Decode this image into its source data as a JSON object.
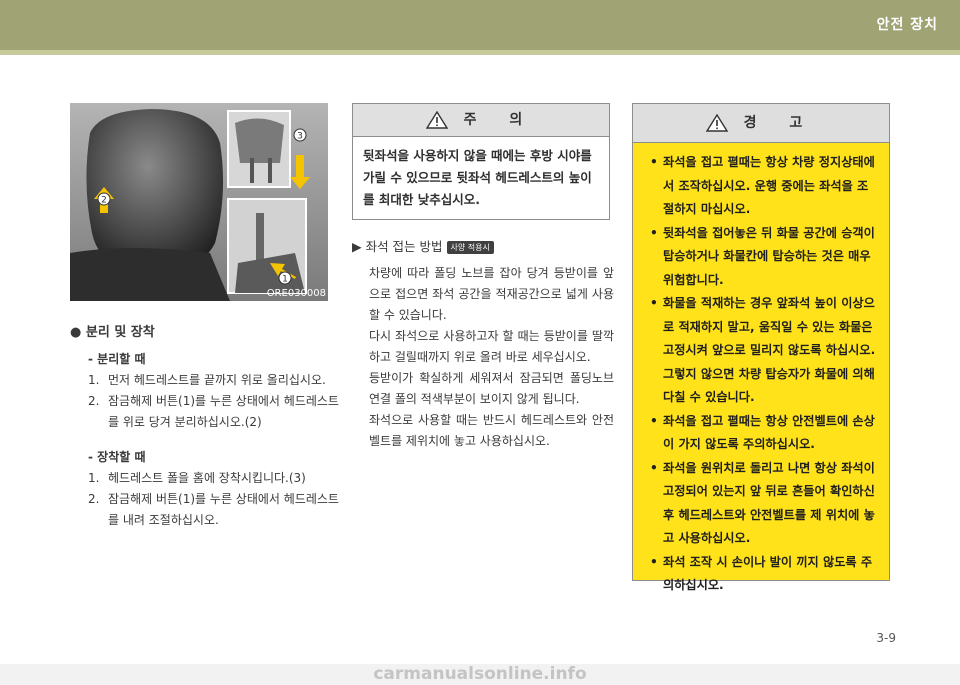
{
  "header": {
    "section": "안전 장치"
  },
  "figure": {
    "caption": "ORE030008",
    "marker1": "1",
    "marker2": "2",
    "marker3": "3"
  },
  "left": {
    "heading": "● 분리 및 장착",
    "sub1": "- 분리할 때",
    "s1_items": [
      {
        "num": "1.",
        "text": "먼저 헤드레스트를 끝까지 위로 올리십시오."
      },
      {
        "num": "2.",
        "text": "잠금해제 버튼(1)를 누른 상태에서 헤드레스트를 위로 당겨 분리하십시오.(2)"
      }
    ],
    "sub2": "- 장착할 때",
    "s2_items": [
      {
        "num": "1.",
        "text": "헤드레스트 폴을 홈에 장착시킵니다.(3)"
      },
      {
        "num": "2.",
        "text": "잠금해제 버튼(1)를 누른 상태에서 헤드레스트를 내려 조절하십시오."
      }
    ]
  },
  "caution": {
    "title": "주 의",
    "text": "뒷좌석을 사용하지 않을 때에는 후방 시야를 가릴 수 있으므로 뒷좌석 헤드레스트의 높이를 최대한 낮추십시오."
  },
  "mid": {
    "heading": "▶ 좌석 접는 방법",
    "badge": "사양 적용시",
    "paras": [
      "차량에 따라 폴딩 노브를 잡아 당겨 등받이를 앞으로 접으면 좌석 공간을 적재공간으로 넓게 사용할 수 있습니다.",
      "다시 좌석으로 사용하고자 할 때는 등받이를 딸깍하고 걸릴때까지 위로 올려 바로 세우십시오.",
      "등받이가 확실하게 세워져서 잠금되면 폴딩노브 연결 폴의 적색부분이 보이지 않게 됩니다.",
      "좌석으로 사용할 때는 반드시 헤드레스트와 안전벨트를 제위치에 놓고 사용하십시오."
    ]
  },
  "warning": {
    "title": "경 고",
    "items": [
      "좌석을 접고 펼때는 항상 차량 정지상태에서 조작하십시오. 운행 중에는 좌석을 조절하지 마십시오.",
      "뒷좌석을 접어놓은 뒤 화물 공간에 승객이 탑승하거나 화물칸에 탑승하는 것은 매우 위험합니다.",
      "화물을 적재하는 경우 앞좌석 높이 이상으로 적재하지 말고, 움직일 수 있는 화물은 고정시켜 앞으로 밀리지 않도록 하십시오. 그렇지 않으면 차량 탑승자가 화물에 의해 다칠 수 있습니다.",
      "좌석을 접고 펼때는 항상 안전벨트에 손상이 가지 않도록 주의하십시오.",
      "좌석을 원위치로 돌리고 나면 항상 좌석이 고정되어 있는지 앞 뒤로 흔들어 확인하신 후 헤드레스트와 안전벨트를 제 위치에 놓고 사용하십시오.",
      "좌석 조작 시 손이나 발이 끼지 않도록 주의하십시오."
    ]
  },
  "footer": {
    "page": "3-9",
    "watermark": "carmanualsonline.info"
  },
  "colors": {
    "header_bar": "#a0a374",
    "warning_bg": "#ffe21a",
    "caution_head": "#e0e0e0"
  }
}
